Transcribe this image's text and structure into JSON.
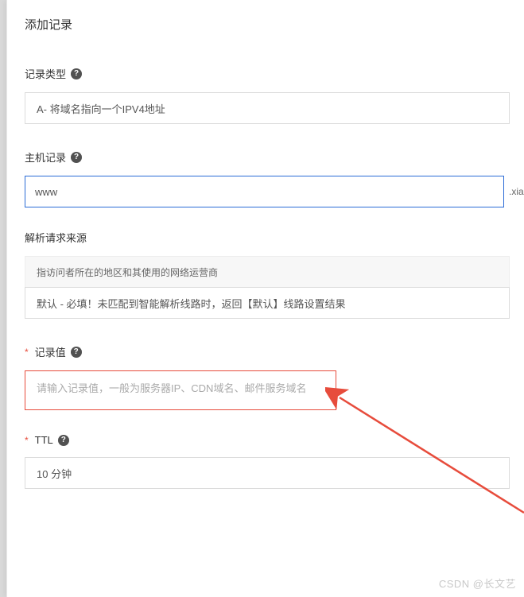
{
  "title": "添加记录",
  "record_type": {
    "label": "记录类型",
    "value": "A- 将域名指向一个IPV4地址"
  },
  "host_record": {
    "label": "主机记录",
    "value": "www",
    "suffix": ".xiao"
  },
  "request_source": {
    "label": "解析请求来源",
    "sublabel": "指访问者所在的地区和其使用的网络运营商",
    "value": "默认 - 必填！未匹配到智能解析线路时，返回【默认】线路设置结果"
  },
  "record_value": {
    "label": "记录值",
    "placeholder": "请输入记录值，一般为服务器IP、CDN域名、邮件服务域名"
  },
  "ttl": {
    "label": "TTL",
    "value": "10 分钟"
  },
  "watermark": "CSDN @长文艺"
}
